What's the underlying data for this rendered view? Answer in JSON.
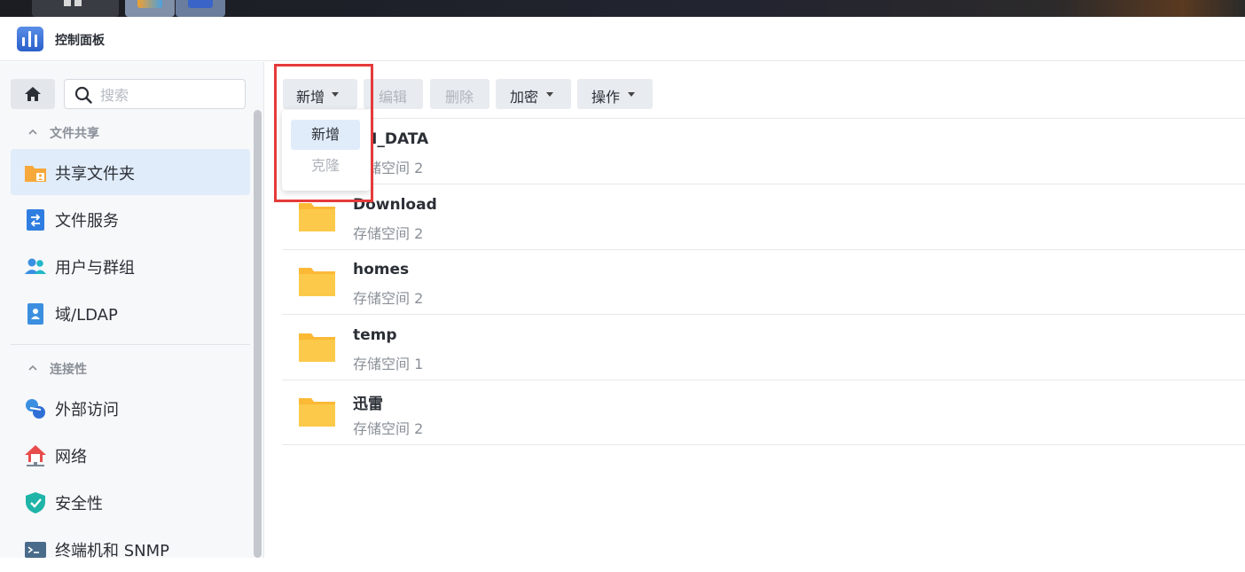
{
  "window": {
    "title": "控制面板"
  },
  "sidebar": {
    "search_placeholder": "搜索",
    "sections": [
      {
        "title": "文件共享"
      },
      {
        "title": "连接性"
      }
    ],
    "items": [
      {
        "label": "共享文件夹",
        "icon": "shared-folder-icon",
        "active": true
      },
      {
        "label": "文件服务",
        "icon": "file-services-icon"
      },
      {
        "label": "用户与群组",
        "icon": "users-icon"
      },
      {
        "label": "域/LDAP",
        "icon": "domain-ldap-icon"
      },
      {
        "label": "外部访问",
        "icon": "external-access-icon"
      },
      {
        "label": "网络",
        "icon": "network-icon"
      },
      {
        "label": "安全性",
        "icon": "security-shield-icon"
      },
      {
        "label": "终端机和 SNMP",
        "icon": "terminal-icon"
      }
    ]
  },
  "toolbar": {
    "create": "新增",
    "edit": "编辑",
    "delete": "删除",
    "encrypt": "加密",
    "action": "操作"
  },
  "dropdown": {
    "items": [
      {
        "label": "新增",
        "state": "hover"
      },
      {
        "label": "克隆",
        "state": "disabled"
      }
    ]
  },
  "folders": [
    {
      "name": "XH_DATA",
      "location": "存储空间 2"
    },
    {
      "name": "Download",
      "location": "存储空间 2"
    },
    {
      "name": "homes",
      "location": "存储空间 2"
    },
    {
      "name": "temp",
      "location": "存储空间 1"
    },
    {
      "name": "迅雷",
      "location": "存储空间 2"
    }
  ],
  "colors": {
    "accent": "#e1ecfa",
    "folder": "#fcc94a",
    "highlight": "#e53a3a"
  }
}
